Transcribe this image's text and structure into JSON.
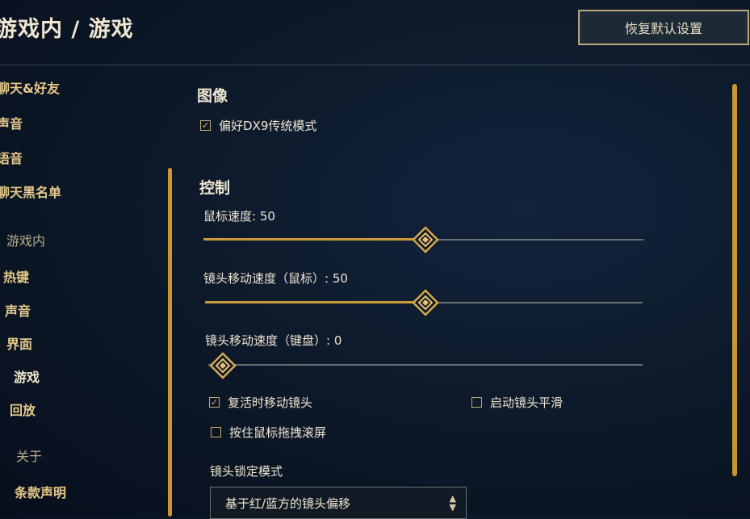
{
  "header": {
    "breadcrumb": "游戏内 / 游戏",
    "restore_button": "恢复默认设置"
  },
  "sidebar": {
    "items": [
      {
        "label": "聊天&好友"
      },
      {
        "label": "声音"
      },
      {
        "label": "语音"
      },
      {
        "label": "聊天黑名单"
      },
      {
        "label": "游戏内"
      },
      {
        "label": "热键"
      },
      {
        "label": "声音"
      },
      {
        "label": "界面"
      },
      {
        "label": "游戏"
      },
      {
        "label": "回放"
      },
      {
        "label": "关于"
      },
      {
        "label": "条款声明"
      }
    ]
  },
  "main": {
    "graphics": {
      "title": "图像",
      "dx9_label": "偏好DX9传统模式",
      "dx9_checked": true
    },
    "controls": {
      "title": "控制",
      "mouse_speed": {
        "label": "鼠标速度: 50",
        "value": 50,
        "max": 100
      },
      "camera_speed_mouse": {
        "label": "镜头移动速度（鼠标）: 50",
        "value": 50,
        "max": 100
      },
      "camera_speed_keyboard": {
        "label": "镜头移动速度（键盘）: 0",
        "value": 0,
        "max": 100
      },
      "move_camera_on_revive": {
        "label": "复活时移动镜头",
        "checked": true
      },
      "camera_smoothing": {
        "label": "启动镜头平滑",
        "checked": false
      },
      "drag_scroll": {
        "label": "按住鼠标拖拽滚屏",
        "checked": false
      },
      "camera_lock_mode": {
        "label": "镜头锁定模式",
        "selected": "基于红/蓝方的镜头偏移"
      }
    }
  },
  "colors": {
    "accent_gold": "#c89b3c",
    "text_light": "#f0e6d2",
    "background": "#0c1828"
  },
  "icons": {
    "check": "checkmark-icon",
    "slider_knob": "diamond-knob-icon",
    "select_arrows": "up-down-chevron-icon"
  }
}
